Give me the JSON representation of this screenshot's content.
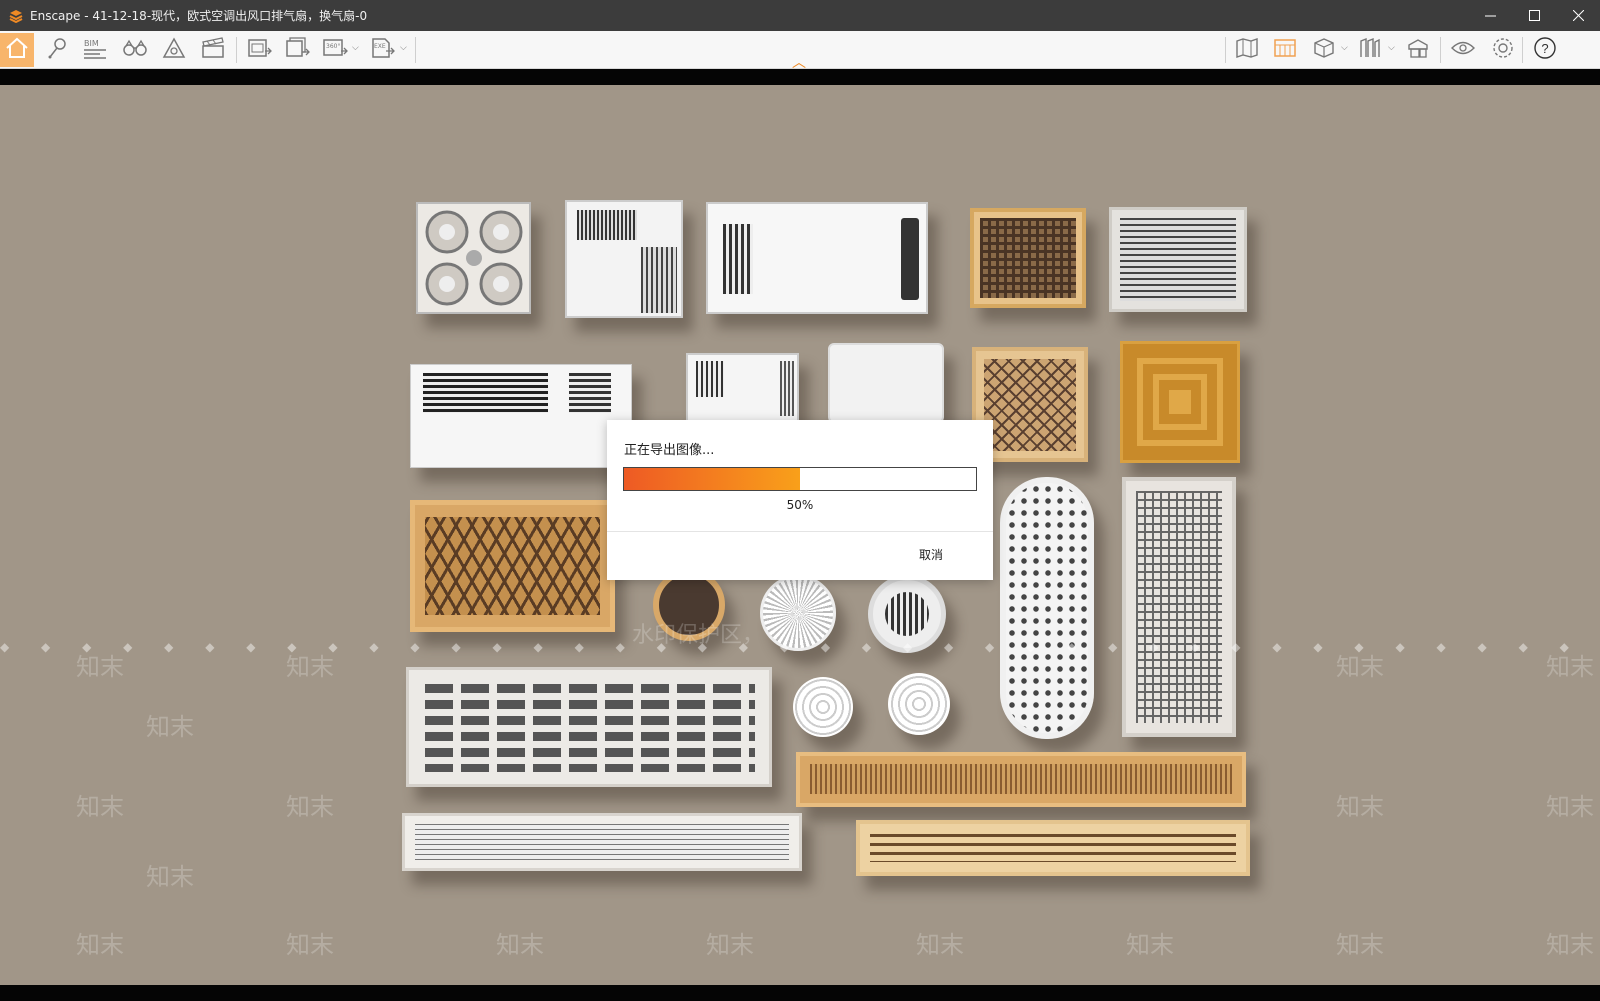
{
  "window": {
    "title": "Enscape - 41-12-18-现代，欧式空调出风口排气扇，换气扇-0",
    "controls": [
      "minimize",
      "maximize",
      "close"
    ]
  },
  "toolbar": {
    "left_buttons": [
      "home-icon",
      "location-pin-icon",
      "bim-icon",
      "binoculars-icon",
      "warning-triangle-icon",
      "clapperboard-icon",
      "render-image-icon",
      "batch-render-icon",
      "panorama-360-icon",
      "export-exe-icon"
    ],
    "right_buttons": [
      "map-icon",
      "material-icon",
      "cube-icon",
      "bookmark-icon",
      "asset-library-icon",
      "eye-icon",
      "settings-gear-icon",
      "help-icon"
    ],
    "bim_label": "BIM",
    "panorama_label": "360°",
    "exe_label": "EXE"
  },
  "colors": {
    "accent": "#f08a24",
    "active_button": "#f8b56b",
    "viewport_bg": "#a19688",
    "titlebar_bg": "#3c3c3c"
  },
  "dialog": {
    "title": "正在导出图像...",
    "progress": 0.5,
    "progress_text": "50%",
    "cancel_label": "取消"
  },
  "watermark": {
    "banner": "水印保护区，",
    "brand": "知末"
  }
}
